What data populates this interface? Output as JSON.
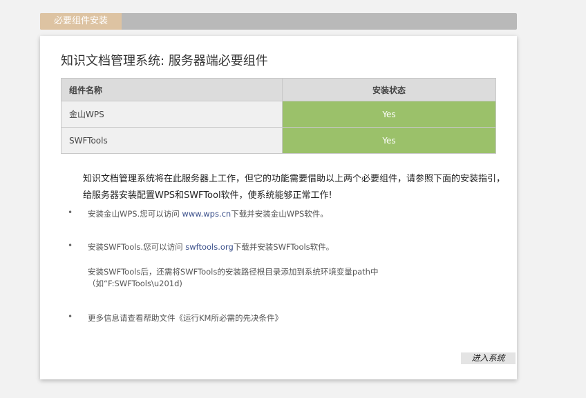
{
  "tab": {
    "label": "必要组件安装"
  },
  "panel": {
    "title": "知识文档管理系统: 服务器端必要组件",
    "table": {
      "headers": [
        "组件名称",
        "安装状态"
      ],
      "rows": [
        {
          "name": "金山WPS",
          "status": "Yes"
        },
        {
          "name": "SWFTools",
          "status": "Yes"
        }
      ]
    },
    "intro": "知识文档管理系统将在此服务器上工作，但它的功能需要借助以上两个必要组件，请参照下面的安装指引，给服务器安装配置WPS和SWFTool软件，使系统能够正常工作!",
    "items": [
      {
        "prefix": "安装金山WPS.您可以访问 ",
        "link": "www.wps.cn",
        "suffix": "下载并安装金山WPS软件。"
      },
      {
        "prefix": "安装SWFTools.您可以访问 ",
        "link": "swftools.org",
        "suffix": "下载并安装SWFTools软件。",
        "note": "安装SWFTools后，还需将SWFTools的安装路径根目录添加到系统环境变量path中 （如“F:SWFTools\\u201d)"
      },
      {
        "text": "更多信息请查看帮助文件《运行KM所必需的先决条件》"
      }
    ],
    "enter_button": "进入系统"
  },
  "colors": {
    "tab_active": "#ddc3a2",
    "tab_bar": "#b9b9b9",
    "status_ok": "#9bc16a",
    "link": "#3a4f8a"
  }
}
